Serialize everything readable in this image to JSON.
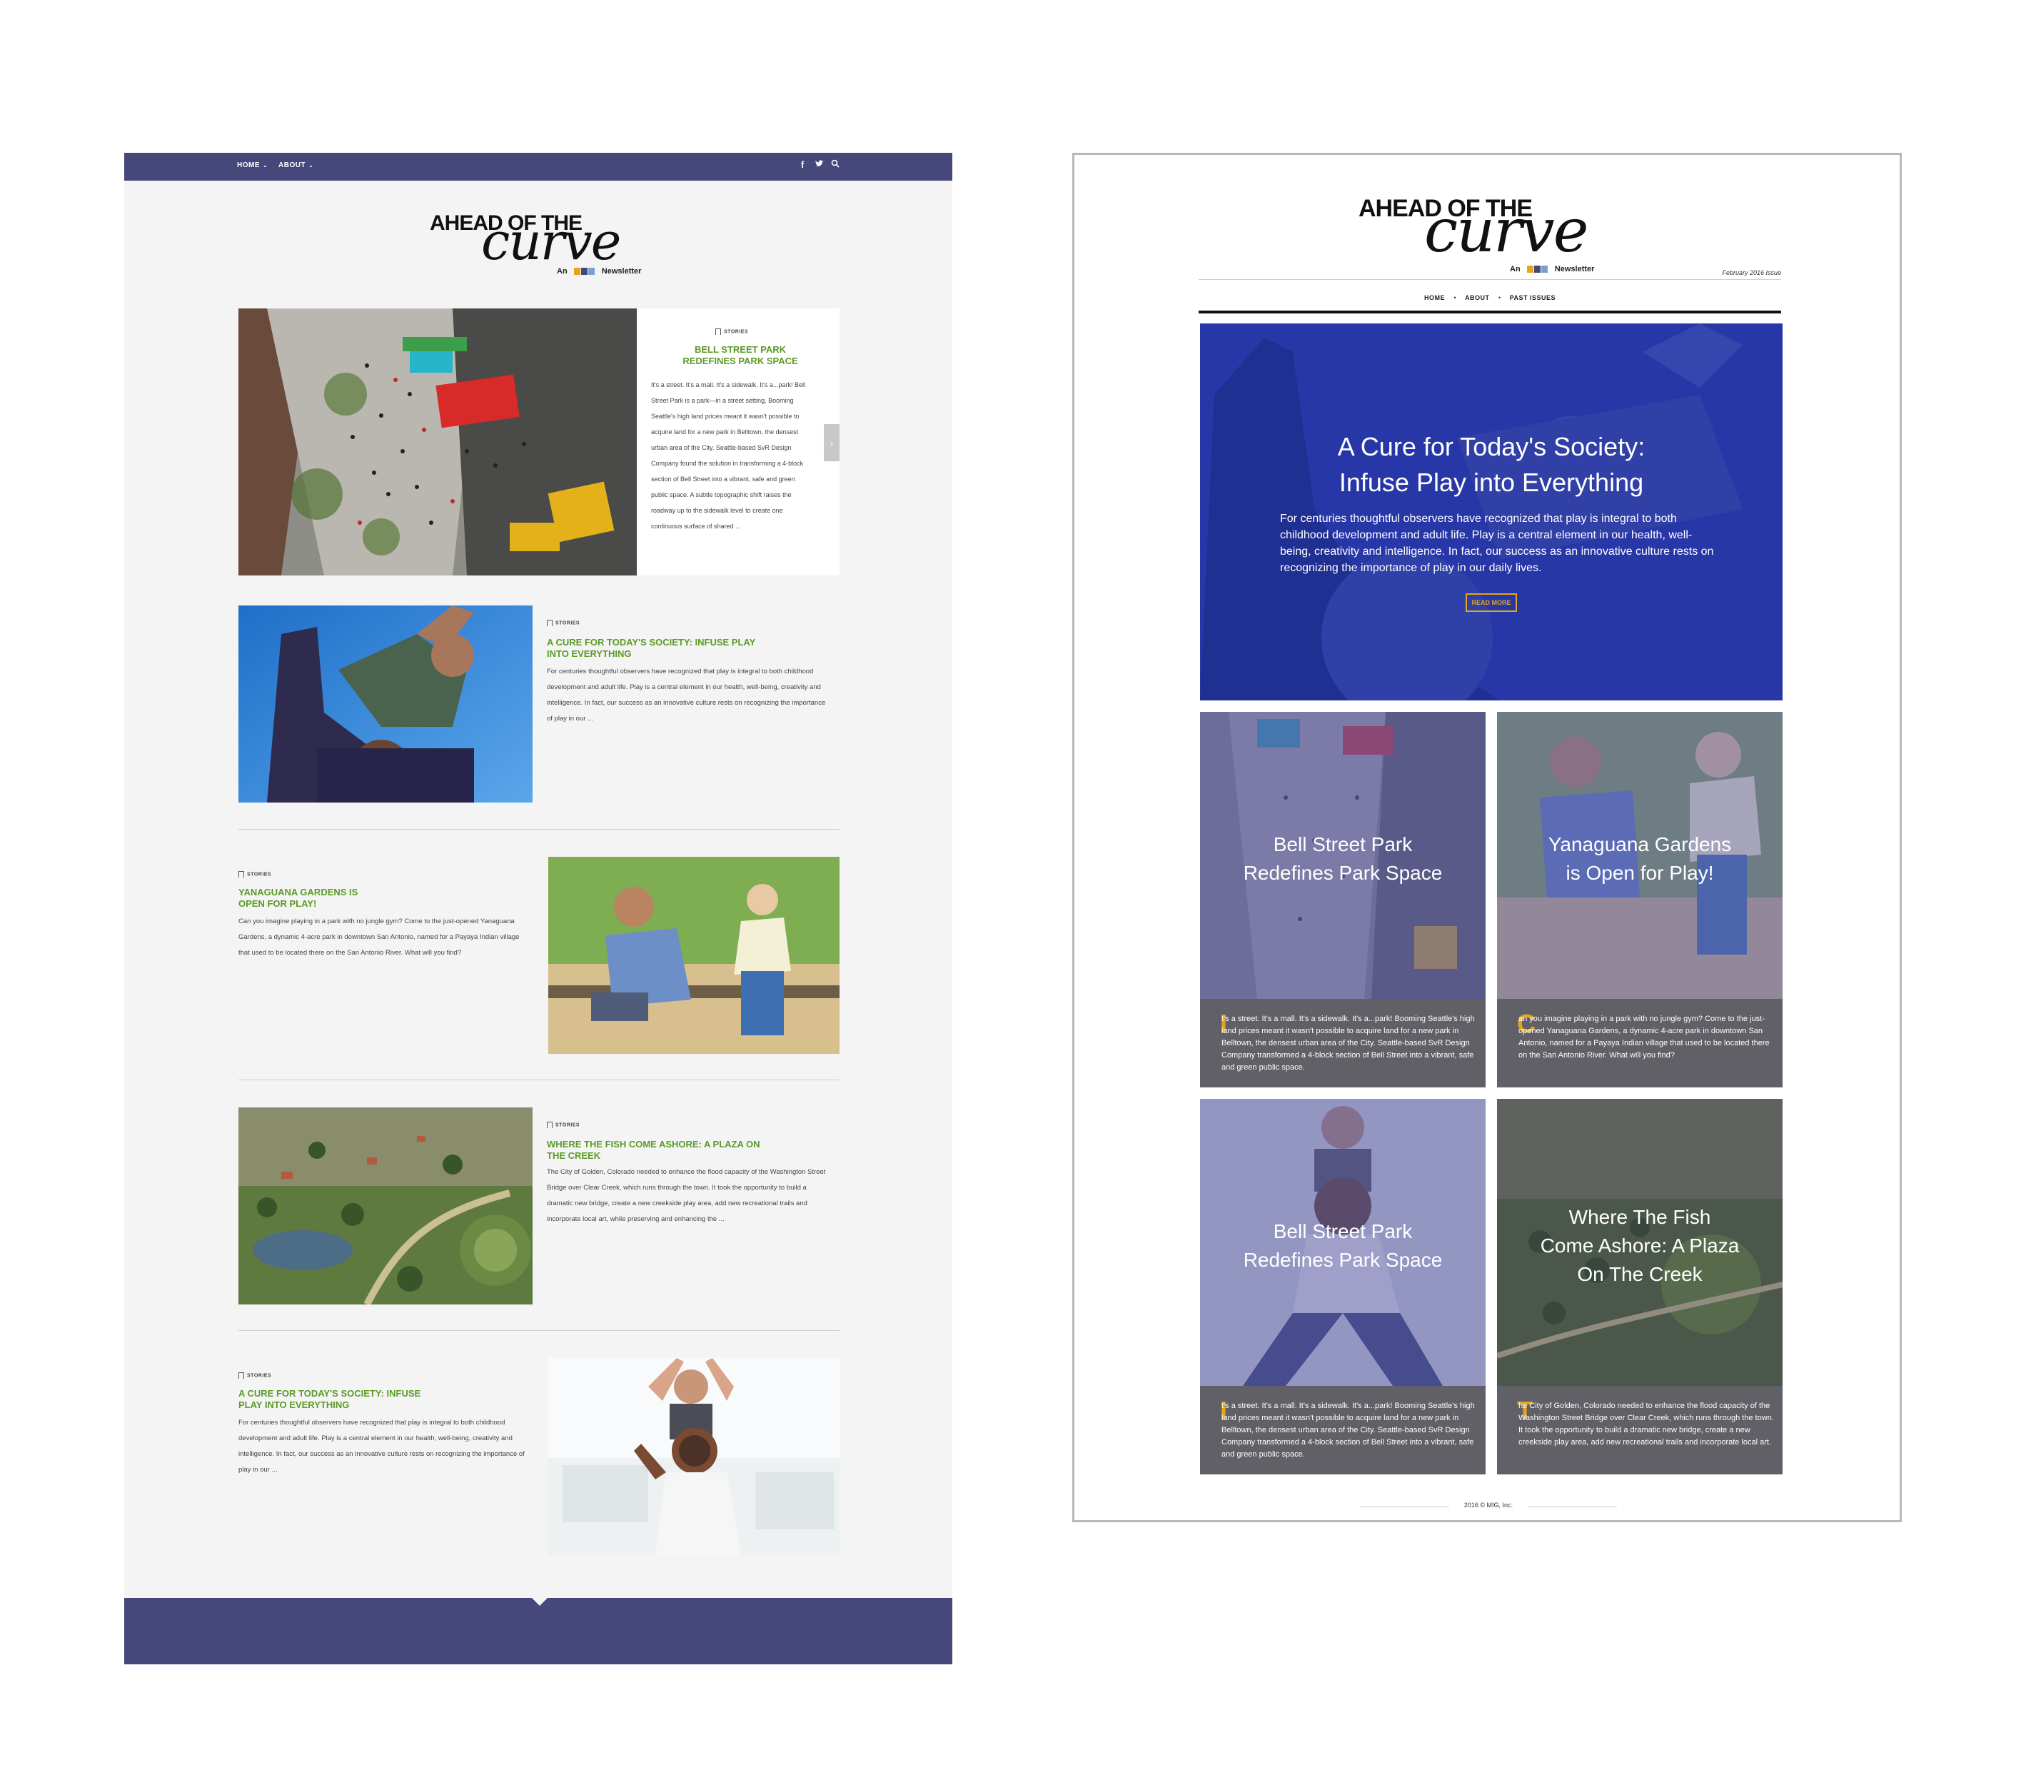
{
  "left": {
    "nav": {
      "home": "HOME",
      "about": "ABOUT"
    },
    "logo": {
      "top": "AHEAD OF THE",
      "script": "curve",
      "sub_prefix": "An",
      "sub_suffix": "Newsletter"
    },
    "articles": [
      {
        "tag": "STORIES",
        "title": "BELL STREET PARK REDEFINES PARK SPACE",
        "body": "It's a street. It's a mall. It's a sidewalk. It's a...park! Bell Street Park is a park—in a street setting. Booming Seattle's high land prices meant it wasn't possible to acquire land for a new park in Belltown, the densest urban area of the City. Seattle-based SvR Design Company found the solution in transforming a 4-block section of Bell Street into a vibrant, safe and green public space. A subtle topographic shift raises the roadway up to the sidewalk level to create one continuous surface of shared ..."
      },
      {
        "tag": "STORIES",
        "title": "A CURE FOR TODAY'S SOCIETY: INFUSE PLAY INTO EVERYTHING",
        "body": "For centuries thoughtful observers have recognized that play is integral to both childhood development and adult life. Play is a central element in our health, well-being, creativity and intelligence. In fact, our success as an innovative culture rests on recognizing the importance of play in our ..."
      },
      {
        "tag": "STORIES",
        "title": "YANAGUANA GARDENS IS OPEN FOR PLAY!",
        "body": "Can you imagine playing in a park with no jungle gym? Come to the just-opened Yanaguana Gardens, a dynamic 4-acre park in downtown San Antonio, named for a Payaya Indian village that used to be located there on the San Antonio River. What will you find?"
      },
      {
        "tag": "STORIES",
        "title": "WHERE THE FISH COME ASHORE: A PLAZA ON THE CREEK",
        "body": "The City of Golden, Colorado needed to enhance the flood capacity of the Washington Street Bridge over Clear Creek, which runs through the town. It took the opportunity to build a dramatic new bridge, create a new creekside play area, add new recreational trails and incorporate local art, while preserving and enhancing the ..."
      },
      {
        "tag": "STORIES",
        "title": "A CURE FOR TODAY'S SOCIETY: INFUSE PLAY INTO EVERYTHING",
        "body": "For centuries thoughtful observers have recognized that play is integral to both childhood development and adult life. Play is a central element in our health, well-being, creativity and intelligence. In fact, our success as an innovative culture rests on recognizing the importance of play in our ..."
      }
    ]
  },
  "right": {
    "logo": {
      "top": "AHEAD OF THE",
      "script": "curve",
      "sub_prefix": "An",
      "sub_suffix": "Newsletter"
    },
    "issue": "February 2016 Issue",
    "nav": [
      "HOME",
      "ABOUT",
      "PAST ISSUES"
    ],
    "hero": {
      "title_line1": "A Cure for Today's Society:",
      "title_line2": "Infuse Play into Everything",
      "body": "For centuries thoughtful observers have recognized that play is integral to both childhood development and adult life. Play is a central element in our health, well-being, creativity and intelligence. In fact, our success as an innovative culture rests on recognizing the importance of play in our daily lives.",
      "button": "READ MORE"
    },
    "tiles": [
      {
        "title_line1": "Bell Street Park",
        "title_line2": "Redefines Park Space",
        "title_line3": "",
        "dropcap": "I",
        "body": "t's a street. It's a mall. It's a sidewalk. It's a...park! Booming Seattle's high land prices meant it wasn't possible to acquire land for a new park in Belltown, the densest urban area of the City. Seattle-based SvR Design Company transformed a 4-block section of Bell Street into a vibrant, safe and green public space."
      },
      {
        "title_line1": "Yanaguana Gardens",
        "title_line2": "is Open for Play!",
        "title_line3": "",
        "dropcap": "C",
        "body": "an you imagine playing in a park with no jungle gym? Come to the just-opened Yanaguana Gardens, a dynamic 4-acre park in downtown San Antonio, named for a Payaya Indian village that used to be located there on the San Antonio River. What will you find?"
      },
      {
        "title_line1": "Bell Street Park",
        "title_line2": "Redefines Park Space",
        "title_line3": "",
        "dropcap": "I",
        "body": "t's a street. It's a mall. It's a sidewalk. It's a...park! Booming Seattle's high land prices meant it wasn't possible to acquire land for a new park in Belltown, the densest urban area of the City. Seattle-based SvR Design Company transformed a 4-block section of Bell Street into a vibrant, safe and green public space."
      },
      {
        "title_line1": "Where The Fish",
        "title_line2": "Come Ashore: A Plaza",
        "title_line3": "On The Creek",
        "dropcap": "T",
        "body": "he City of Golden, Colorado needed to enhance the flood capacity of the Washington Street Bridge over Clear Creek, which runs through the town. It took the opportunity to build a dramatic new bridge, create a new creekside play area, add new recreational trails and incorporate local art."
      }
    ],
    "footer": "2016 © MIG, Inc."
  },
  "colors": {
    "nav": "#46477a",
    "green_title": "#5a9b25",
    "accent_gold": "#e2a51c",
    "hero_overlay": "#2b3aa6",
    "tile_overlay": "#5c5ca8"
  },
  "icons": [
    "facebook-icon",
    "twitter-icon",
    "search-icon",
    "bookmark-icon",
    "next-arrow-icon"
  ]
}
